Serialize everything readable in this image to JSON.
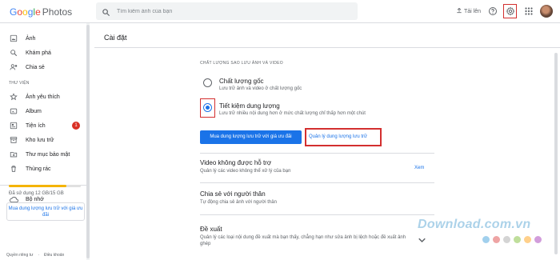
{
  "app": {
    "logo_google": "Google",
    "logo_photos": "Photos"
  },
  "search": {
    "placeholder": "Tìm kiếm ảnh của bạn"
  },
  "topbar": {
    "upload_label": "Tải lên"
  },
  "sidebar": {
    "items": [
      {
        "label": "Ảnh",
        "icon": "photo-icon"
      },
      {
        "label": "Khám phá",
        "icon": "explore-icon"
      },
      {
        "label": "Chia sẻ",
        "icon": "share-icon"
      }
    ],
    "library_heading": "THƯ VIỆN",
    "library_items": [
      {
        "label": "Ảnh yêu thích",
        "icon": "star-icon"
      },
      {
        "label": "Album",
        "icon": "album-icon"
      },
      {
        "label": "Tiện ích",
        "icon": "utilities-icon",
        "badge": "1"
      },
      {
        "label": "Kho lưu trữ",
        "icon": "archive-icon"
      },
      {
        "label": "Thư mục bảo mật",
        "icon": "lock-folder-icon"
      },
      {
        "label": "Thùng rác",
        "icon": "trash-icon"
      }
    ],
    "storage": {
      "label": "Bộ nhớ",
      "usage_text": "Đã sử dụng 12 GB/15 GB",
      "used_fraction": 0.8,
      "buy_label": "Mua dung lượng lưu trữ với giá ưu đãi"
    },
    "footer": {
      "privacy": "Quyền riêng tư",
      "terms": "Điều khoản",
      "dot": "·"
    }
  },
  "settings": {
    "title": "Cài đặt",
    "backup_heading": "CHẤT LƯỢNG SAO LƯU ẢNH VÀ VIDEO",
    "options": [
      {
        "title": "Chất lượng gốc",
        "desc": "Lưu trữ ảnh và video ở chất lượng gốc",
        "selected": false
      },
      {
        "title": "Tiết kiệm dung lượng",
        "desc": "Lưu trữ nhiều nội dung hơn ở mức chất lượng chỉ thấp hơn một chút",
        "selected": true
      }
    ],
    "buy_button": "Mua dung lượng lưu trữ với giá ưu đãi",
    "manage_link": "Quản lý dung lượng lưu trữ",
    "rows": [
      {
        "title": "Video không được hỗ trợ",
        "desc": "Quản lý các video không thể xử lý của bạn",
        "link": "Xem"
      },
      {
        "title": "Chia sẻ với người thân",
        "desc": "Tự động chia sẻ ảnh với người thân"
      },
      {
        "title": "Đề xuất",
        "desc": "Quản lý các loại nội dung đề xuất mà bạn thấy, chẳng hạn như sửa ảnh bị lệch hoặc đề xuất ảnh ghép"
      }
    ]
  },
  "watermark": {
    "text": "Download.com.vn"
  },
  "colors": {
    "accent": "#1a73e8",
    "highlight": "#d32f2f",
    "badge": "#d93025",
    "storage": "#f4b400"
  }
}
